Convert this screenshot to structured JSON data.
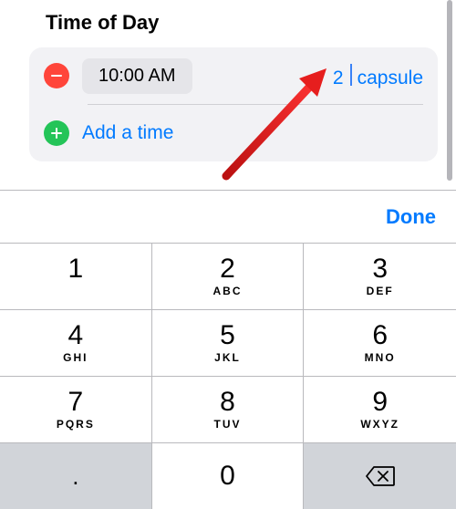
{
  "section": {
    "title": "Time of Day"
  },
  "schedule": {
    "time": "10:00 AM",
    "dose_value": "2",
    "dose_unit": "capsule"
  },
  "actions": {
    "add_time": "Add a time",
    "done": "Done"
  },
  "keypad": {
    "keys": [
      {
        "num": "1",
        "sub": ""
      },
      {
        "num": "2",
        "sub": "ABC"
      },
      {
        "num": "3",
        "sub": "DEF"
      },
      {
        "num": "4",
        "sub": "GHI"
      },
      {
        "num": "5",
        "sub": "JKL"
      },
      {
        "num": "6",
        "sub": "MNO"
      },
      {
        "num": "7",
        "sub": "PQRS"
      },
      {
        "num": "8",
        "sub": "TUV"
      },
      {
        "num": "9",
        "sub": "WXYZ"
      }
    ],
    "dot": ".",
    "zero": "0"
  }
}
